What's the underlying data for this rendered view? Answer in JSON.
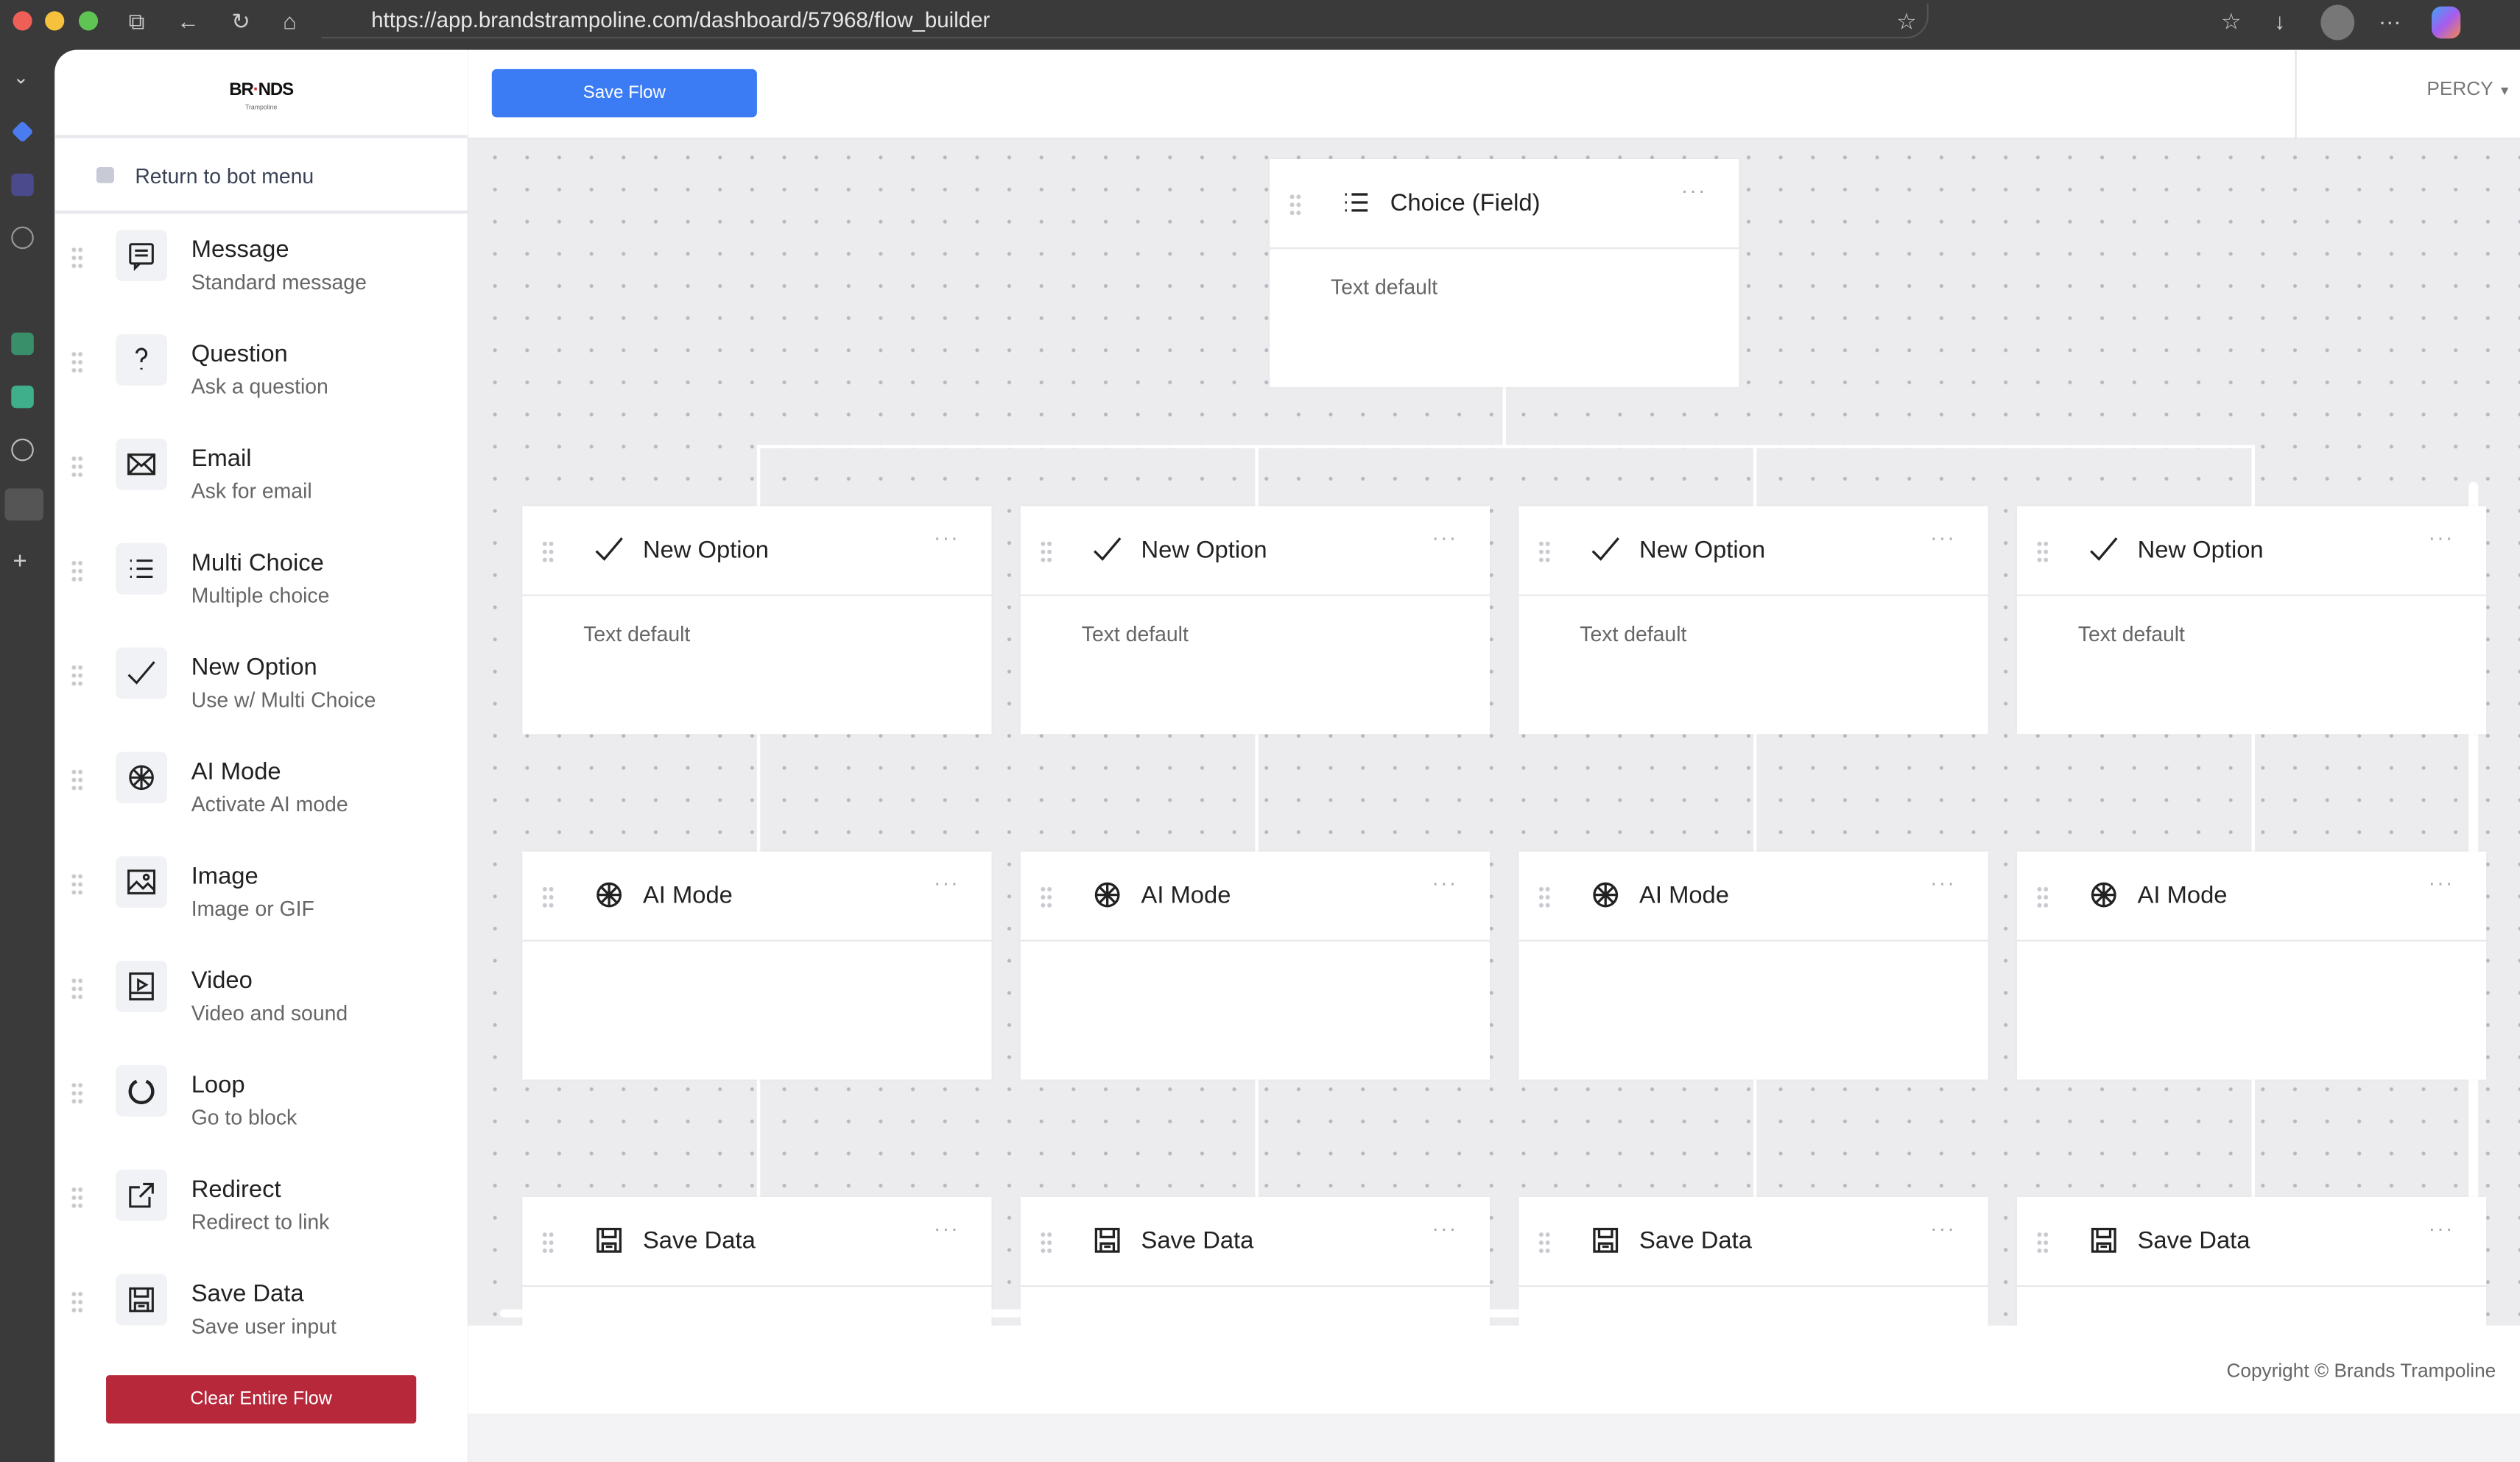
{
  "browser": {
    "url": "https://app.brandstrampoline.com/dashboard/57968/flow_builder"
  },
  "logo": {
    "text": "BR·NDS",
    "sub": "Trampoline"
  },
  "sidebar": {
    "return_label": "Return to bot menu",
    "items": [
      {
        "title": "Message",
        "subtitle": "Standard message",
        "icon": "message-icon"
      },
      {
        "title": "Question",
        "subtitle": "Ask a question",
        "icon": "question-icon"
      },
      {
        "title": "Email",
        "subtitle": "Ask for email",
        "icon": "email-icon"
      },
      {
        "title": "Multi Choice",
        "subtitle": "Multiple choice",
        "icon": "list-icon"
      },
      {
        "title": "New Option",
        "subtitle": "Use w/ Multi Choice",
        "icon": "check-icon"
      },
      {
        "title": "AI Mode",
        "subtitle": "Activate AI mode",
        "icon": "ai-icon"
      },
      {
        "title": "Image",
        "subtitle": "Image or GIF",
        "icon": "image-icon"
      },
      {
        "title": "Video",
        "subtitle": "Video and sound",
        "icon": "video-icon"
      },
      {
        "title": "Loop",
        "subtitle": "Go to block",
        "icon": "loop-icon"
      },
      {
        "title": "Redirect",
        "subtitle": "Redirect to link",
        "icon": "redirect-icon"
      },
      {
        "title": "Save Data",
        "subtitle": "Save user input",
        "icon": "save-icon"
      }
    ],
    "clear_label": "Clear Entire Flow"
  },
  "header": {
    "save_label": "Save Flow",
    "user": "PERCY"
  },
  "canvas": {
    "root": {
      "title": "Choice (Field)",
      "body": "Text default",
      "icon": "list-icon"
    },
    "columns": [
      {
        "option": {
          "title": "New Option",
          "body": "Text default"
        },
        "ai": {
          "title": "AI Mode"
        },
        "save": {
          "title": "Save Data"
        }
      },
      {
        "option": {
          "title": "New Option",
          "body": "Text default"
        },
        "ai": {
          "title": "AI Mode"
        },
        "save": {
          "title": "Save Data"
        }
      },
      {
        "option": {
          "title": "New Option",
          "body": "Text default"
        },
        "ai": {
          "title": "AI Mode"
        },
        "save": {
          "title": "Save Data"
        }
      },
      {
        "option": {
          "title": "New Option",
          "body": "Text default"
        },
        "ai": {
          "title": "AI Mode"
        },
        "save": {
          "title": "Save Data"
        }
      }
    ],
    "node_menu": "···"
  },
  "footer": {
    "copyright": "Copyright © Brands Trampoline"
  },
  "colors": {
    "primary": "#3b7cf5",
    "danger": "#b7283a"
  }
}
